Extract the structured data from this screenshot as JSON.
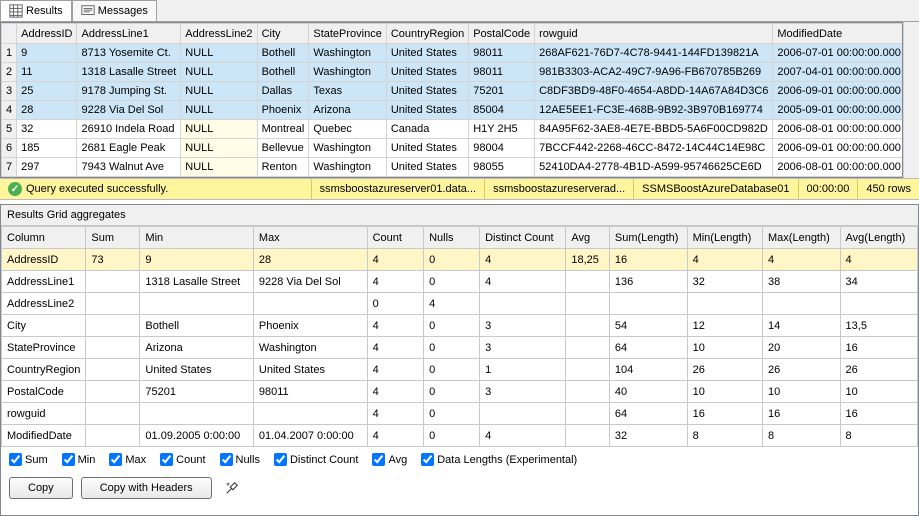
{
  "tabs": {
    "results": "Results",
    "messages": "Messages"
  },
  "grid": {
    "headers": [
      "AddressID",
      "AddressLine1",
      "AddressLine2",
      "City",
      "StateProvince",
      "CountryRegion",
      "PostalCode",
      "rowguid",
      "ModifiedDate"
    ],
    "rows": [
      {
        "n": "1",
        "sel": true,
        "c": [
          "9",
          "8713 Yosemite Ct.",
          "NULL",
          "Bothell",
          "Washington",
          "United States",
          "98011",
          "268AF621-76D7-4C78-9441-144FD139821A",
          "2006-07-01 00:00:00.000"
        ]
      },
      {
        "n": "2",
        "sel": true,
        "c": [
          "11",
          "1318 Lasalle Street",
          "NULL",
          "Bothell",
          "Washington",
          "United States",
          "98011",
          "981B3303-ACA2-49C7-9A96-FB670785B269",
          "2007-04-01 00:00:00.000"
        ]
      },
      {
        "n": "3",
        "sel": true,
        "c": [
          "25",
          "9178 Jumping St.",
          "NULL",
          "Dallas",
          "Texas",
          "United States",
          "75201",
          "C8DF3BD9-48F0-4654-A8DD-14A67A84D3C6",
          "2006-09-01 00:00:00.000"
        ]
      },
      {
        "n": "4",
        "sel": true,
        "c": [
          "28",
          "9228 Via Del Sol",
          "NULL",
          "Phoenix",
          "Arizona",
          "United States",
          "85004",
          "12AE5EE1-FC3E-468B-9B92-3B970B169774",
          "2005-09-01 00:00:00.000"
        ]
      },
      {
        "n": "5",
        "sel": false,
        "c": [
          "32",
          "26910 Indela Road",
          "NULL",
          "Montreal",
          "Quebec",
          "Canada",
          "H1Y 2H5",
          "84A95F62-3AE8-4E7E-BBD5-5A6F00CD982D",
          "2006-08-01 00:00:00.000"
        ]
      },
      {
        "n": "6",
        "sel": false,
        "c": [
          "185",
          "2681 Eagle Peak",
          "NULL",
          "Bellevue",
          "Washington",
          "United States",
          "98004",
          "7BCCF442-2268-46CC-8472-14C44C14E98C",
          "2006-09-01 00:00:00.000"
        ]
      },
      {
        "n": "7",
        "sel": false,
        "c": [
          "297",
          "7943 Walnut Ave",
          "NULL",
          "Renton",
          "Washington",
          "United States",
          "98055",
          "52410DA4-2778-4B1D-A599-95746625CE6D",
          "2006-08-01 00:00:00.000"
        ]
      }
    ]
  },
  "status": {
    "msg": "Query executed successfully.",
    "server": "ssmsboostazureserver01.data...",
    "admin": "ssmsboostazureserverad...",
    "db": "SSMSBoostAzureDatabase01",
    "time": "00:00:00",
    "rows": "450 rows"
  },
  "aggTitle": "Results Grid aggregates",
  "agg": {
    "headers": [
      "Column",
      "Sum",
      "Min",
      "Max",
      "Count",
      "Nulls",
      "Distinct Count",
      "Avg",
      "Sum(Length)",
      "Min(Length)",
      "Max(Length)",
      "Avg(Length)"
    ],
    "rows": [
      {
        "sel": true,
        "c": [
          "AddressID",
          "73",
          "9",
          "28",
          "4",
          "0",
          "4",
          "18,25",
          "16",
          "4",
          "4",
          "4"
        ]
      },
      {
        "sel": false,
        "c": [
          "AddressLine1",
          "",
          "1318 Lasalle Street",
          "9228 Via Del Sol",
          "4",
          "0",
          "4",
          "",
          "136",
          "32",
          "38",
          "34"
        ]
      },
      {
        "sel": false,
        "c": [
          "AddressLine2",
          "",
          "",
          "",
          "0",
          "4",
          "",
          "",
          "",
          "",
          "",
          ""
        ]
      },
      {
        "sel": false,
        "c": [
          "City",
          "",
          "Bothell",
          "Phoenix",
          "4",
          "0",
          "3",
          "",
          "54",
          "12",
          "14",
          "13,5"
        ]
      },
      {
        "sel": false,
        "c": [
          "StateProvince",
          "",
          "Arizona",
          "Washington",
          "4",
          "0",
          "3",
          "",
          "64",
          "10",
          "20",
          "16"
        ]
      },
      {
        "sel": false,
        "c": [
          "CountryRegion",
          "",
          "United States",
          "United States",
          "4",
          "0",
          "1",
          "",
          "104",
          "26",
          "26",
          "26"
        ]
      },
      {
        "sel": false,
        "c": [
          "PostalCode",
          "",
          "75201",
          "98011",
          "4",
          "0",
          "3",
          "",
          "40",
          "10",
          "10",
          "10"
        ]
      },
      {
        "sel": false,
        "c": [
          "rowguid",
          "",
          "",
          "",
          "4",
          "0",
          "",
          "",
          "64",
          "16",
          "16",
          "16"
        ]
      },
      {
        "sel": false,
        "c": [
          "ModifiedDate",
          "",
          "01.09.2005 0:00:00",
          "01.04.2007 0:00:00",
          "4",
          "0",
          "4",
          "",
          "32",
          "8",
          "8",
          "8"
        ]
      }
    ]
  },
  "checks": {
    "sum": "Sum",
    "min": "Min",
    "max": "Max",
    "count": "Count",
    "nulls": "Nulls",
    "distinct": "Distinct Count",
    "avg": "Avg",
    "len": "Data Lengths (Experimental)"
  },
  "buttons": {
    "copy": "Copy",
    "copyh": "Copy with Headers"
  }
}
